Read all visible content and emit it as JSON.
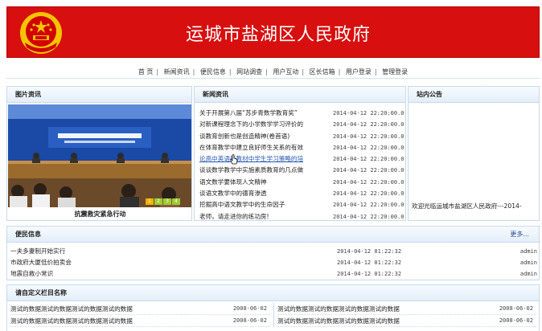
{
  "header": {
    "title": "运城市盐湖区人民政府"
  },
  "nav": {
    "items": [
      "首 页",
      "新闻资讯",
      "便民信息",
      "网站调查",
      "用户互动",
      "区长信箱",
      "用户登录",
      "管理登录"
    ]
  },
  "photo": {
    "heading": "图片资讯",
    "caption": "抗震救灾紧急行动",
    "pager": [
      "1",
      "2",
      "3",
      "4"
    ]
  },
  "news": {
    "heading": "新闻资讯",
    "items": [
      {
        "title": "关于开展第八届“苏步青数学教育奖”",
        "date": "2014-04-12 22:20:00.0"
      },
      {
        "title": "对新课程理念下的小学数学学习评价的",
        "date": "2014-04-12 22:20:00.0"
      },
      {
        "title": "谈教育创新也是创造精神(卷首语)",
        "date": "2014-04-12 22:20:00.0"
      },
      {
        "title": "在体育教学中建立良好师生关系的有效",
        "date": "2014-04-12 22:20:00.0"
      },
      {
        "title": "论高中英语新教材中学生学习策略的培",
        "date": "2014-04-12 22:20:00.0"
      },
      {
        "title": "谈谈数学教学中实施素质教育的几点做",
        "date": "2014-04-12 22:20:00.0"
      },
      {
        "title": "语文数学要体现人文精神",
        "date": "2014-04-12 22:20:00.0"
      },
      {
        "title": "谈语文教学中的德育渗透",
        "date": "2014-04-12 22:20:00.0"
      },
      {
        "title": "挖掘高中语文教学中的生命因子",
        "date": "2014-04-12 22:20:00.0"
      },
      {
        "title": "老师，请走进你的练功房!",
        "date": "2014-04-12 22:20:00.0"
      }
    ]
  },
  "notice": {
    "heading": "站内公告",
    "text": "欢迎光临运城市盐湖区人民政府---2014-"
  },
  "info": {
    "heading": "便民信息",
    "more": "更多...",
    "items": [
      {
        "title": "一夫多妻制开始实行",
        "date": "2014-04-12 01:22:32",
        "author": "admin"
      },
      {
        "title": "市政府大厦低价拍卖会",
        "date": "2014-04-12 01:22:32",
        "author": "admin"
      },
      {
        "title": "地震自救小常识",
        "date": "2014-04-12 01:22:32",
        "author": "admin"
      }
    ]
  },
  "custom": {
    "heading": "请自定义栏目名称",
    "left": [
      {
        "title": "测试的数据测试的数据测试的数据测试的数据",
        "date": "2008-06-02"
      },
      {
        "title": "测试的数据测试的数据测试的数据测试的数据",
        "date": "2008-06-02"
      }
    ],
    "right": [
      {
        "title": "测试的数据测试的数据测试的数据测试的数据",
        "date": "2008-06-02"
      },
      {
        "title": "测试的数据测试的数据测试的数据测试的数据",
        "date": "2008-06-02"
      }
    ]
  },
  "colors": {
    "header_red": "#d80f0f",
    "link_blue": "#2456b0",
    "border": "#c8d9ea"
  }
}
